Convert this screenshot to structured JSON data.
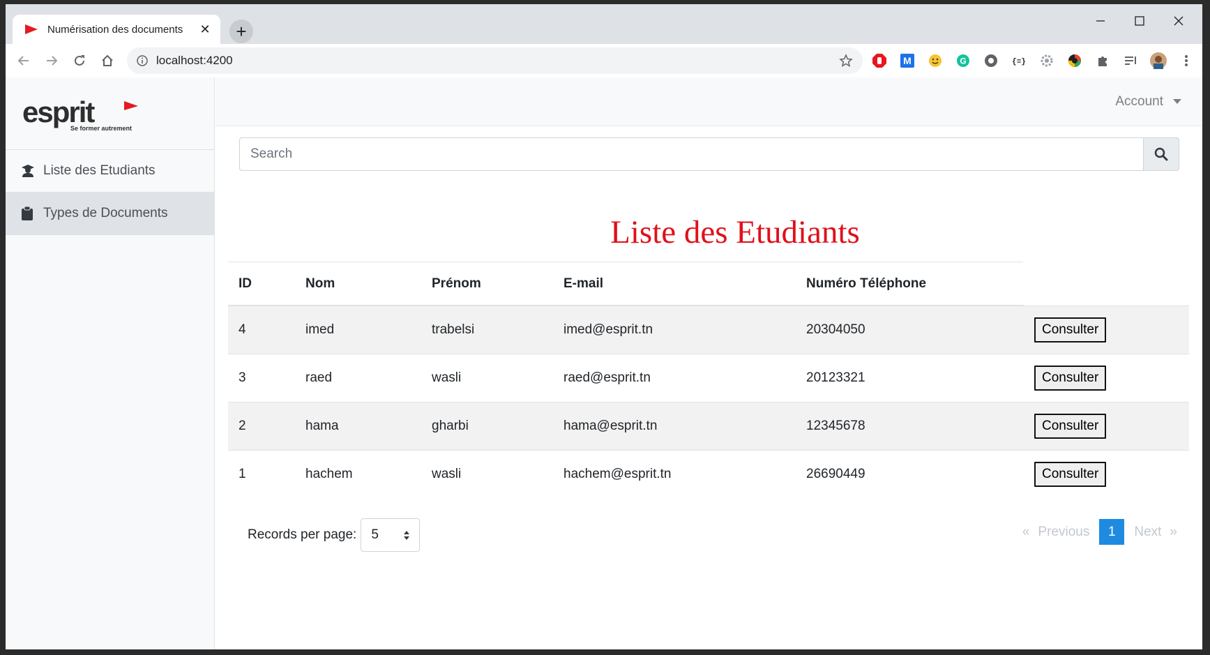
{
  "browser": {
    "tab_title": "Numérisation des documents",
    "tab_close": "✕",
    "new_tab": "+",
    "url": "localhost:4200"
  },
  "sidebar": {
    "brand_main": "esprit",
    "brand_tagline": "Se former autrement",
    "items": [
      {
        "label": "Liste des Etudiants",
        "icon": "student-icon"
      },
      {
        "label": "Types de Documents",
        "icon": "clipboard-icon"
      }
    ]
  },
  "topnav": {
    "account_label": "Account"
  },
  "search": {
    "placeholder": "Search"
  },
  "page": {
    "title": "Liste des Etudiants"
  },
  "table": {
    "headers": [
      "ID",
      "Nom",
      "Prénom",
      "E-mail",
      "Numéro Téléphone"
    ],
    "rows": [
      {
        "id": "4",
        "nom": "imed",
        "prenom": "trabelsi",
        "email": "imed@esprit.tn",
        "tel": "20304050",
        "action": "Consulter"
      },
      {
        "id": "3",
        "nom": "raed",
        "prenom": "wasli",
        "email": "raed@esprit.tn",
        "tel": "20123321",
        "action": "Consulter"
      },
      {
        "id": "2",
        "nom": "hama",
        "prenom": "gharbi",
        "email": "hama@esprit.tn",
        "tel": "12345678",
        "action": "Consulter"
      },
      {
        "id": "1",
        "nom": "hachem",
        "prenom": "wasli",
        "email": "hachem@esprit.tn",
        "tel": "26690449",
        "action": "Consulter"
      }
    ]
  },
  "pagination": {
    "records_label": "Records per page:",
    "records_value": "5",
    "first": "«",
    "previous": "Previous",
    "current": "1",
    "next": "Next",
    "last": "»"
  },
  "colors": {
    "title": "#e0101a",
    "accent": "#1e8be0",
    "brand_red": "#e31b23"
  }
}
